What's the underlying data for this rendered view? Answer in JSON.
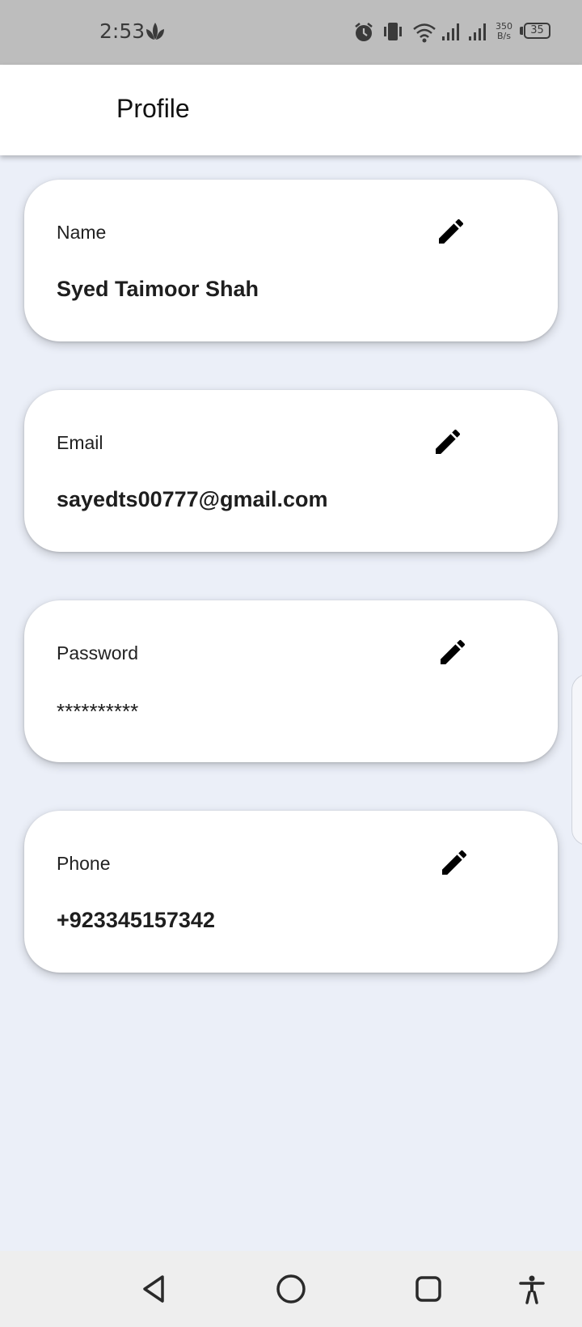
{
  "status_bar": {
    "time": "2:53",
    "net_speed_value": "350",
    "net_speed_unit": "B/s",
    "battery": "35",
    "icons": [
      "leaf-icon",
      "alarm-icon",
      "vibrate-icon",
      "wifi-icon",
      "signal-icon",
      "signal-icon",
      "battery-icon"
    ]
  },
  "app_bar": {
    "title": "Profile"
  },
  "cards": [
    {
      "label": "Name",
      "value": "Syed Taimoor Shah",
      "icon": "edit-icon"
    },
    {
      "label": "Email",
      "value": "sayedts00777@gmail.com",
      "icon": "edit-icon"
    },
    {
      "label": "Password",
      "value": "**********",
      "icon": "edit-icon"
    },
    {
      "label": "Phone",
      "value": "+923345157342",
      "icon": "edit-icon"
    }
  ],
  "nav_bar": {
    "icons": [
      "back-icon",
      "home-icon",
      "recents-icon",
      "accessibility-icon"
    ]
  },
  "colors": {
    "background": "#ebeff8",
    "card": "#ffffff",
    "status_bar": "#bdbdbd",
    "nav_bar": "#eeeeee"
  }
}
